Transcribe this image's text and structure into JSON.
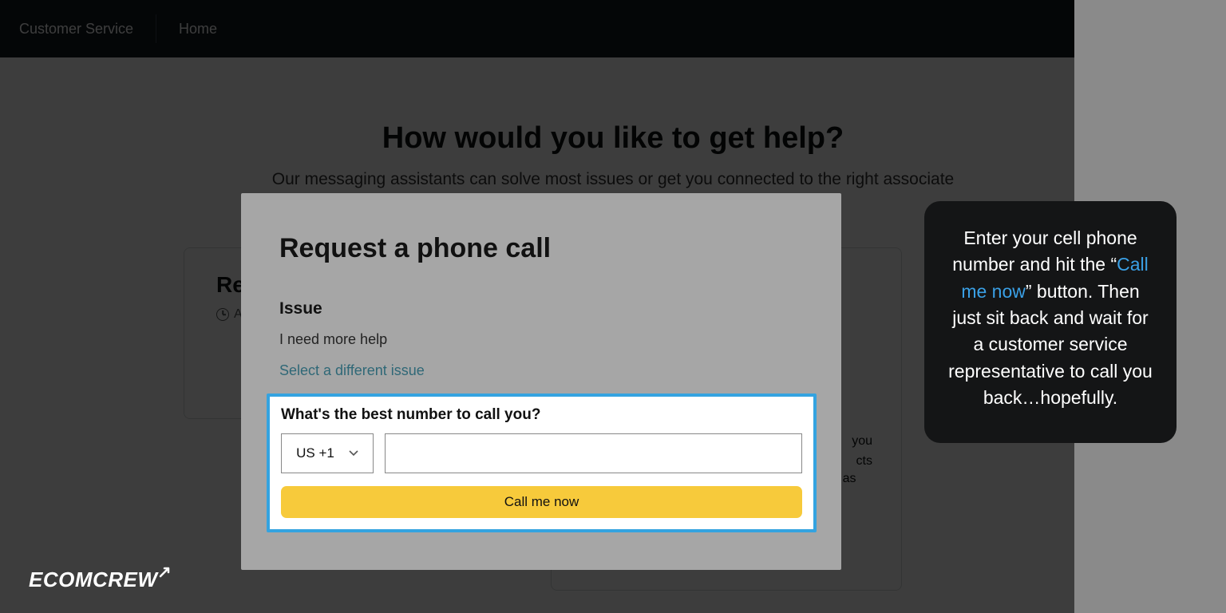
{
  "topbar": {
    "customer_service": "Customer Service",
    "home": "Home"
  },
  "background": {
    "title": "How would you like to get help?",
    "subtitle": "Our messaging assistants can solve most issues or get you connected to the right associate",
    "card1_title_fragment": "Re",
    "card1_meta_fragment": "A",
    "card2_line1_fragment": "you",
    "card2_line2_fragment": "cts",
    "card2_line3_fragment": "go as"
  },
  "modal": {
    "title": "Request a phone call",
    "issue_label": "Issue",
    "issue_text": "I need more help",
    "select_different": "Select a different issue",
    "question": "What's the best number to call you?",
    "country_code": "US +1",
    "call_button": "Call me now"
  },
  "callout": {
    "pre": "Enter your cell phone number and hit the “",
    "highlight": "Call me now",
    "post": "” button. Then just sit back and wait for a customer service representative to call you back…hopefully."
  },
  "logo": {
    "text": "ECOMCREW"
  }
}
